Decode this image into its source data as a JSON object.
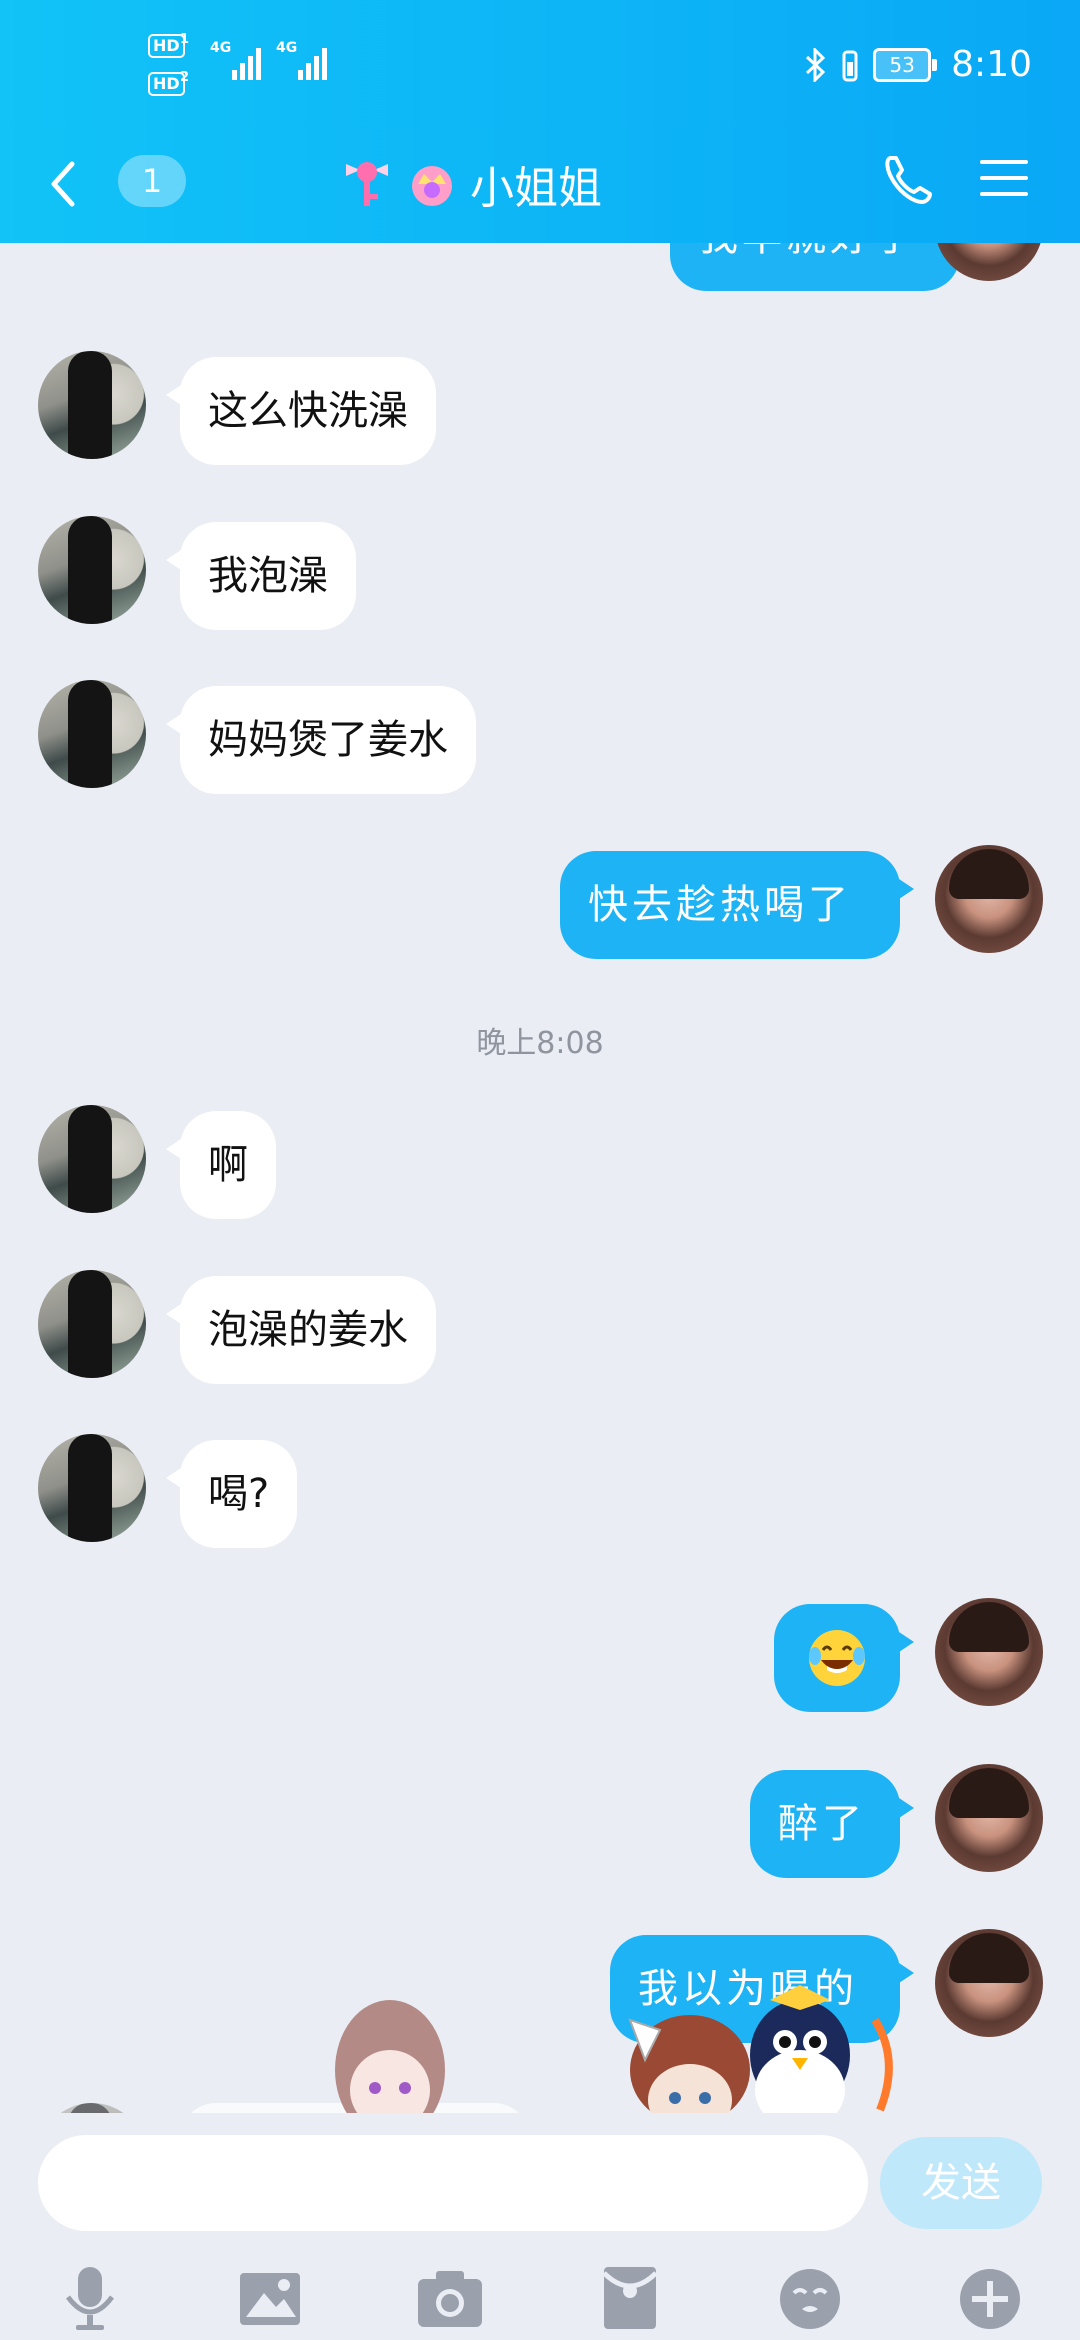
{
  "status_bar": {
    "hd1": "HD",
    "sim1": "1",
    "hd2": "HD",
    "sim2": "2",
    "net1": "4G",
    "net2": "4G",
    "battery": "53",
    "time": "8:10"
  },
  "nav": {
    "unread": "1",
    "title": "小姐姐"
  },
  "messages": [
    {
      "side": "out",
      "text": "我早就好了",
      "partial": true
    },
    {
      "side": "in",
      "text": "这么快洗澡"
    },
    {
      "side": "in",
      "text": "我泡澡"
    },
    {
      "side": "in",
      "text": "妈妈煲了姜水"
    },
    {
      "side": "out",
      "text": "快去趁热喝了"
    },
    {
      "side": "in",
      "text": "啊"
    },
    {
      "side": "in",
      "text": "泡澡的姜水"
    },
    {
      "side": "in",
      "text": "喝?"
    },
    {
      "side": "out",
      "text": "😂",
      "emoji": "laughing-tears"
    },
    {
      "side": "out",
      "text": "醉了"
    },
    {
      "side": "out",
      "text": "我以为喝的"
    }
  ],
  "timestamp": "晚上8:08",
  "composer": {
    "input_value": "",
    "send_label": "发送"
  },
  "toolbar_icons": [
    "microphone-icon",
    "image-icon",
    "camera-icon",
    "red-packet-icon",
    "emoji-icon",
    "plus-icon"
  ],
  "colors": {
    "header": "#0aa8f6",
    "outgoing_bubble": "#1eb3f5",
    "incoming_bubble": "#ffffff",
    "background": "#eaedf4",
    "send_disabled": "#bfe8fb"
  }
}
